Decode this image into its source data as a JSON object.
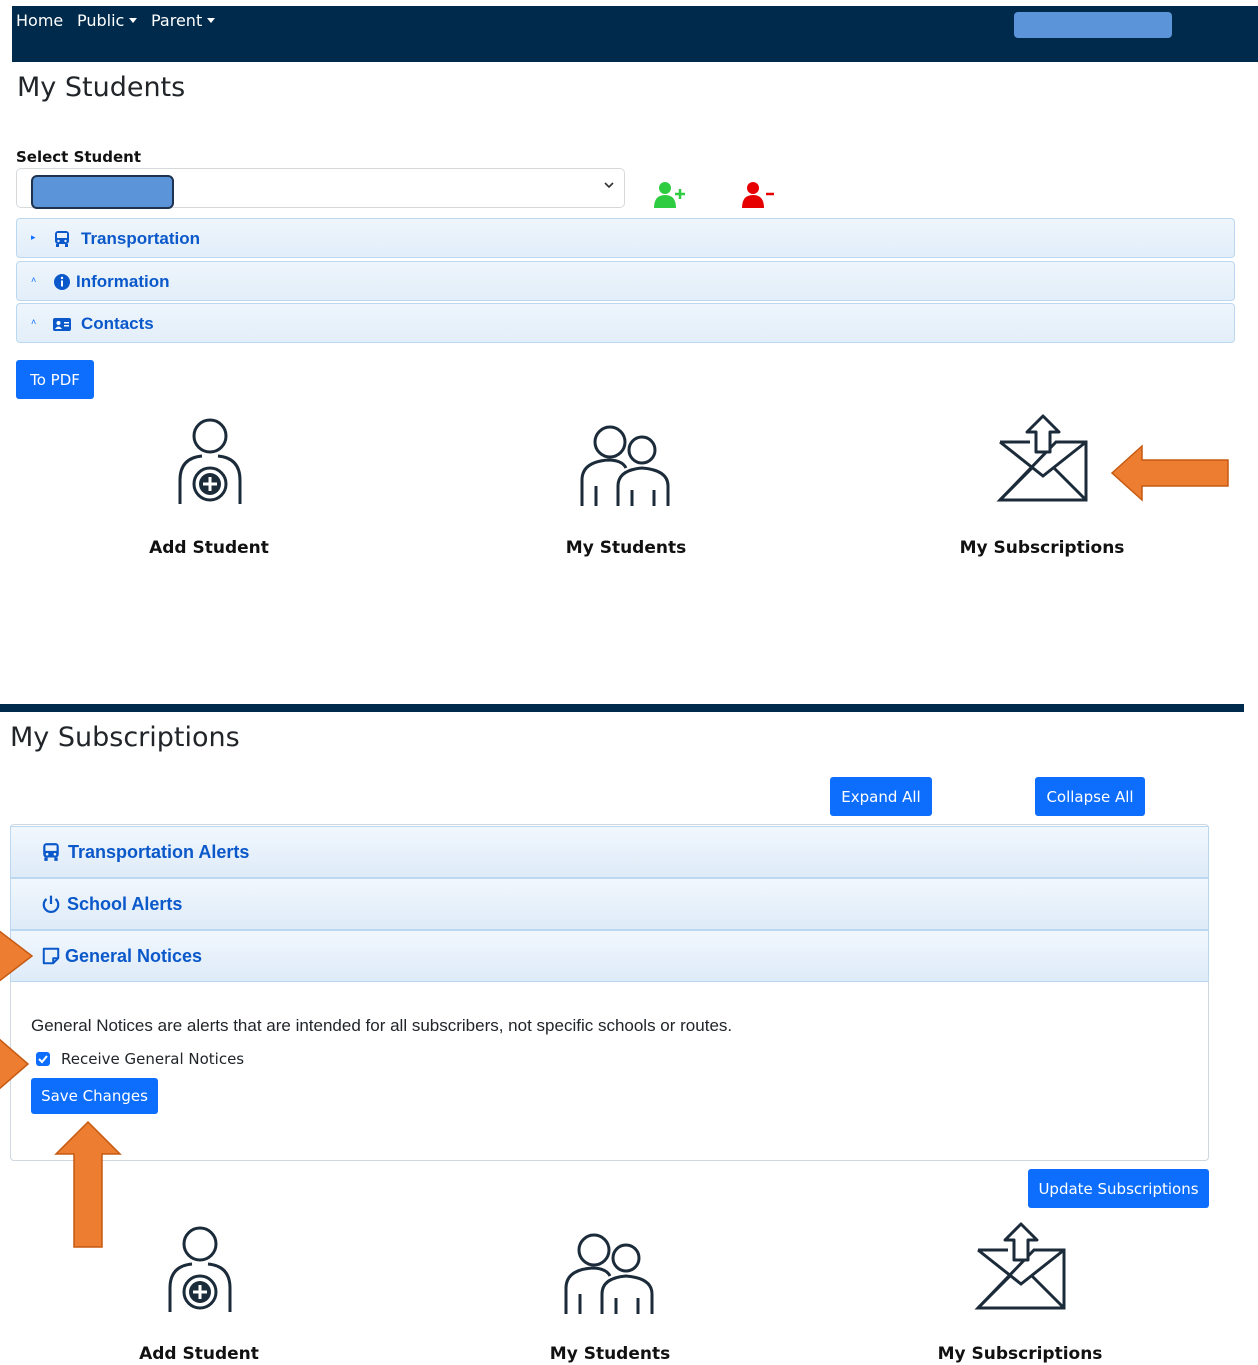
{
  "colors": {
    "navbar": "#002a4c",
    "primary": "#0d6efd",
    "link": "#0a58ca",
    "add_green": "#2ecc40",
    "remove_red": "#e60000",
    "callout_arrow": "#ed7d31"
  },
  "navbar": {
    "items": [
      {
        "label": "Home"
      },
      {
        "label": "Public"
      },
      {
        "label": "Parent"
      }
    ]
  },
  "students_page": {
    "title": "My Students",
    "select_label": "Select Student",
    "sections": [
      {
        "label": "Transportation",
        "icon": "bus-icon"
      },
      {
        "label": "Information",
        "icon": "info-icon"
      },
      {
        "label": "Contacts",
        "icon": "contact-card-icon"
      }
    ],
    "pdf_button": "To PDF"
  },
  "tiles": [
    {
      "label": "Add Student",
      "icon": "add-person-icon"
    },
    {
      "label": "My Students",
      "icon": "people-icon"
    },
    {
      "label": "My Subscriptions",
      "icon": "envelope-upload-icon"
    }
  ],
  "subscriptions_page": {
    "title": "My Subscriptions",
    "expand_all": "Expand All",
    "collapse_all": "Collapse All",
    "sections": [
      {
        "label": "Transportation Alerts",
        "icon": "bus-icon"
      },
      {
        "label": "School Alerts",
        "icon": "power-icon"
      },
      {
        "label": "General Notices",
        "icon": "note-icon"
      }
    ],
    "general_notices_text": "General Notices are alerts that are intended for all subscribers, not specific schools or routes.",
    "checkbox_label": "Receive General Notices",
    "checkbox_checked": true,
    "save_button": "Save Changes",
    "update_button": "Update Subscriptions"
  }
}
